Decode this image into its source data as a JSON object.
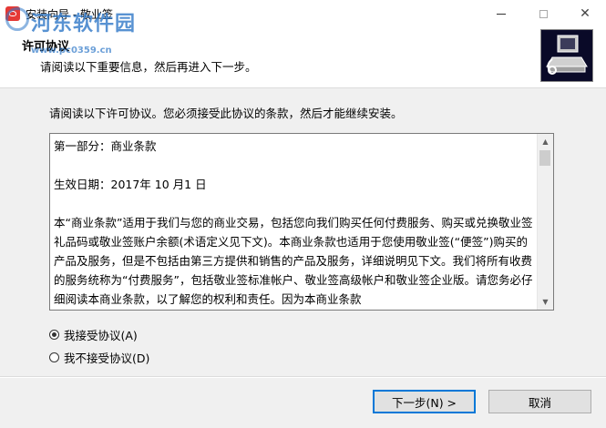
{
  "window": {
    "title": "安装向导 - 敬业签",
    "minimize_glyph": "—",
    "maximize_glyph": "☐",
    "close_glyph": "✕"
  },
  "watermark": {
    "site_name": "河东软件园",
    "site_url": "www.pc0359.cn"
  },
  "header": {
    "title": "许可协议",
    "subtitle": "请阅读以下重要信息，然后再进入下一步。"
  },
  "body": {
    "intro": "请阅读以下许可协议。您必须接受此协议的条款，然后才能继续安装。"
  },
  "license": {
    "paragraphs": [
      "第一部分：商业条款",
      "生效日期：2017年 10 月1 日",
      "本“商业条款”适用于我们与您的商业交易，包括您向我们购买任何付费服务、购买或兑换敬业签礼品码或敬业签账户余额(术语定义见下文)。本商业条款也适用于您使用敬业签(“便签”)购买的产品及服务，但是不包括由第三方提供和销售的产品及服务，详细说明见下文。我们将所有收费的服务统称为“付费服务”，包括敬业签标准帐户、敬业签高级帐户和敬业签企业版。请您务必仔细阅读本商业条款，以了解您的权利和责任。因为本商业条款"
    ]
  },
  "radios": {
    "accept_label": "我接受协议(A)",
    "decline_label": "我不接受协议(D)",
    "selected": "accept"
  },
  "buttons": {
    "next_label": "下一步(N) >",
    "cancel_label": "取消"
  },
  "colors": {
    "accent": "#0078d7",
    "app_icon": "#e53935",
    "watermark": "#2f78c8"
  }
}
